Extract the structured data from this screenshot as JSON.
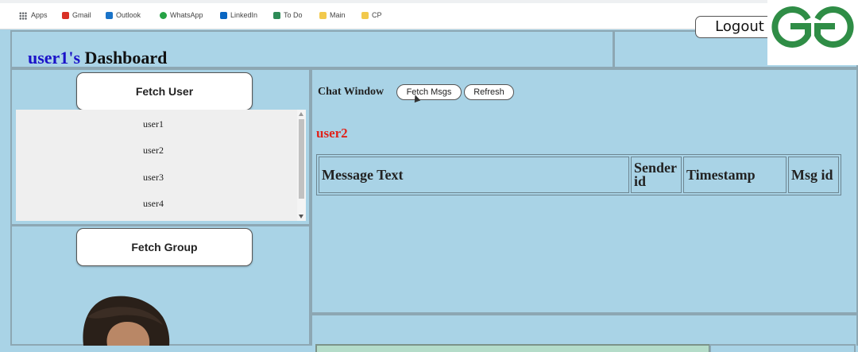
{
  "bookmarks": [
    {
      "label": "Apps",
      "icon": "apps-grid-icon"
    },
    {
      "label": "Gmail",
      "icon": "gmail-icon",
      "color": "#d93025"
    },
    {
      "label": "Outlook",
      "icon": "outlook-icon",
      "color": "#1a73c8"
    },
    {
      "label": "WhatsApp",
      "icon": "whatsapp-icon",
      "color": "#25a244"
    },
    {
      "label": "LinkedIn",
      "icon": "linkedin-icon",
      "color": "#0a66c2"
    },
    {
      "label": "To Do",
      "icon": "todo-icon",
      "color": "#2e8b57"
    },
    {
      "label": "Main",
      "icon": "folder-icon",
      "color": "#f2c94c"
    },
    {
      "label": "CP",
      "icon": "folder-icon",
      "color": "#f2c94c"
    }
  ],
  "header": {
    "title_user": "user1's",
    "title_rest": " Dashboard",
    "logout_label": "Logout"
  },
  "logo": {
    "name": "geeksforgeeks-logo-icon",
    "color": "#2f8d46"
  },
  "sidebar": {
    "fetch_user_label": "Fetch User",
    "users": [
      "user1",
      "user2",
      "user3",
      "user4"
    ],
    "fetch_group_label": "Fetch Group"
  },
  "chat": {
    "window_label": "Chat Window",
    "fetch_msgs_label": "Fetch Msgs",
    "refresh_label": "Refresh",
    "selected_user": "user2",
    "columns": [
      "Message Text",
      "Sender id",
      "Timestamp",
      "Msg id"
    ]
  },
  "colors": {
    "page_bg": "#a9d3e6",
    "title_user": "#1a12c9",
    "selected_user": "#e0231b"
  }
}
